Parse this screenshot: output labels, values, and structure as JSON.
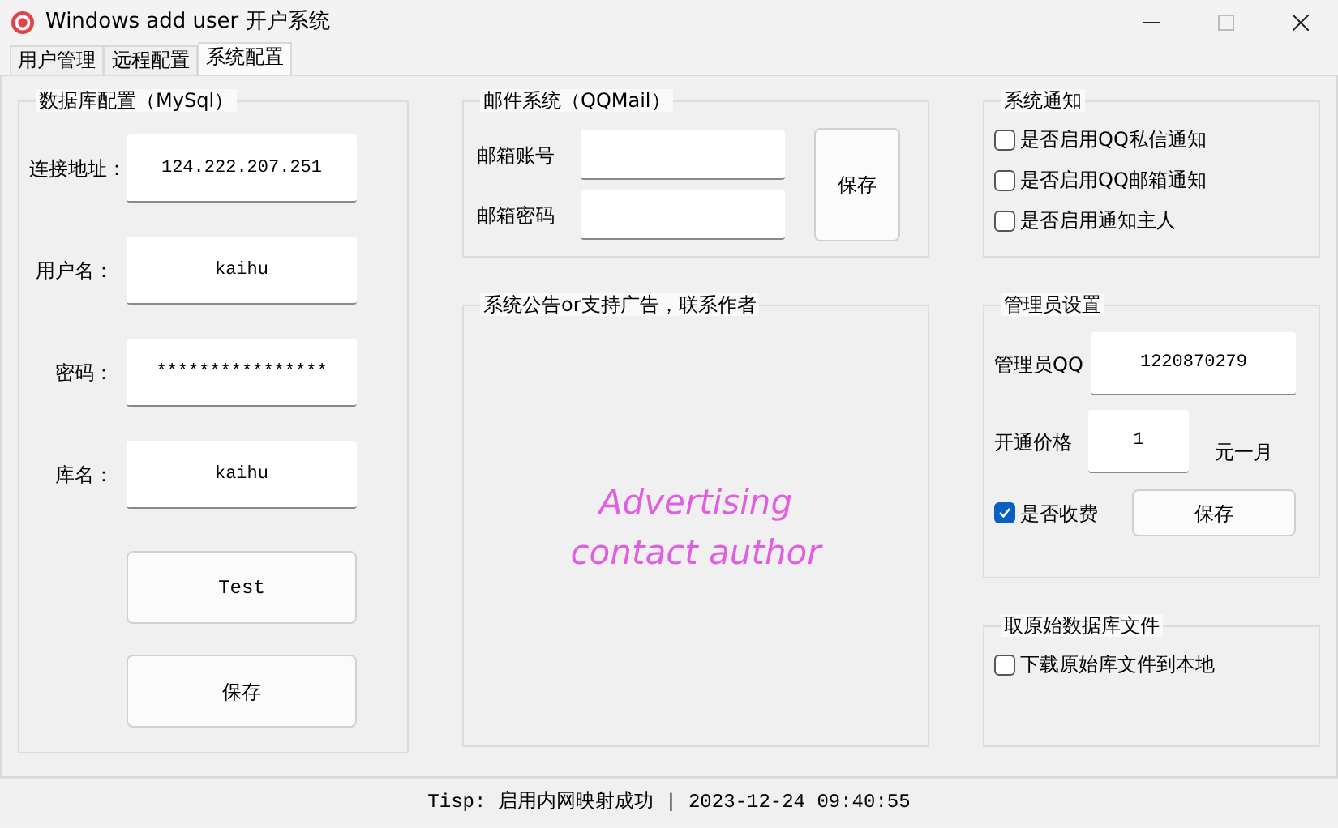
{
  "window": {
    "title": "Windows add user 开户系统"
  },
  "tabs": [
    {
      "label": "用户管理",
      "selected": false
    },
    {
      "label": "远程配置",
      "selected": false
    },
    {
      "label": "系统配置",
      "selected": true
    }
  ],
  "database": {
    "title": "数据库配置（MySql）",
    "fields": [
      {
        "label": "连接地址：",
        "value": "124.222.207.251"
      },
      {
        "label": "用户名：",
        "value": "kaihu"
      },
      {
        "label": "密码：",
        "value": "****************"
      },
      {
        "label": "库名：",
        "value": "kaihu"
      }
    ],
    "buttons": [
      "Test",
      "保存"
    ]
  },
  "mail": {
    "title": "邮件系统（QQMail）",
    "fields": [
      {
        "label": "邮箱账号"
      },
      {
        "label": "邮箱密码"
      }
    ],
    "button": "保存"
  },
  "ad": {
    "title": "系统公告or支持广告，联系作者",
    "lines": [
      "Advertising",
      "contact author"
    ]
  },
  "notifications": {
    "title": "系统通知",
    "options": [
      {
        "label": "是否启用QQ私信通知",
        "checked": false
      },
      {
        "label": "是否启用QQ邮箱通知",
        "checked": false
      },
      {
        "label": "是否启用通知主人",
        "checked": false
      }
    ]
  },
  "admin": {
    "title": "管理员设置",
    "qq_label": "管理员QQ",
    "qq": "1220870279",
    "price_label": "开通价格",
    "price": "1",
    "unit": "元一月",
    "charge": {
      "label": "是否收费",
      "checked": true
    },
    "button": "保存"
  },
  "export": {
    "title": "取原始数据库文件",
    "options": [
      {
        "label": "下载原始库文件到本地",
        "checked": false
      }
    ]
  },
  "status_bar": "Tisp: 启用内网映射成功 | 2023-12-24 09:40:55"
}
